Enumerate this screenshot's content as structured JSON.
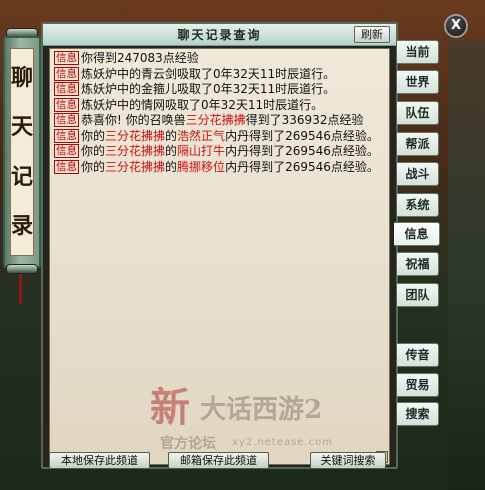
{
  "window": {
    "title": "聊天记录查询",
    "refresh_label": "刷新",
    "close_label": "X"
  },
  "side_scroll": {
    "chars": [
      "聊",
      "天",
      "记",
      "录"
    ]
  },
  "messages": [
    {
      "tag": "信息",
      "parts": [
        {
          "text": "你得到247083点经验",
          "red": false
        }
      ]
    },
    {
      "tag": "信息",
      "parts": [
        {
          "text": "炼妖炉中的青云剑吸取了0年32天11时辰道行。",
          "red": false
        }
      ]
    },
    {
      "tag": "信息",
      "parts": [
        {
          "text": "炼妖炉中的金箍儿吸取了0年32天11时辰道行。",
          "red": false
        }
      ]
    },
    {
      "tag": "信息",
      "parts": [
        {
          "text": "炼妖炉中的情网吸取了0年32天11时辰道行。",
          "red": false
        }
      ]
    },
    {
      "tag": "信息",
      "parts": [
        {
          "text": "恭喜你! 你的召唤兽",
          "red": false
        },
        {
          "text": "三分花拂拂",
          "red": true
        },
        {
          "text": "得到了336932点经验",
          "red": false
        }
      ]
    },
    {
      "tag": "信息",
      "parts": [
        {
          "text": "你的",
          "red": false
        },
        {
          "text": "三分花拂拂",
          "red": true
        },
        {
          "text": "的",
          "red": false
        },
        {
          "text": "浩然正气",
          "red": true
        },
        {
          "text": "内丹得到了269546点经验。",
          "red": false
        }
      ]
    },
    {
      "tag": "信息",
      "parts": [
        {
          "text": "你的",
          "red": false
        },
        {
          "text": "三分花拂拂",
          "red": true
        },
        {
          "text": "的",
          "red": false
        },
        {
          "text": "隔山打牛",
          "red": true
        },
        {
          "text": "内丹得到了269546点经验。",
          "red": false
        }
      ]
    },
    {
      "tag": "信息",
      "parts": [
        {
          "text": "你的",
          "red": false
        },
        {
          "text": "三分花拂拂",
          "red": true
        },
        {
          "text": "的",
          "red": false
        },
        {
          "text": "腾挪移位",
          "red": true
        },
        {
          "text": "内丹得到了269546点经验。",
          "red": false
        }
      ]
    }
  ],
  "watermark": {
    "big_char": "新",
    "title": "大话西游2",
    "sub1": "官方论坛",
    "sub2": "xy2.netease.com"
  },
  "bottom_buttons": [
    "本地保存此频道",
    "邮箱保存此频道",
    "关键词搜索"
  ],
  "right_tabs": [
    "当前",
    "世界",
    "队伍",
    "帮派",
    "战斗",
    "系统",
    "信息",
    "祝福",
    "团队",
    "传音",
    "贸易",
    "搜索"
  ],
  "active_tab": "信息",
  "scroll_down_icon": "chevron-down-icon"
}
